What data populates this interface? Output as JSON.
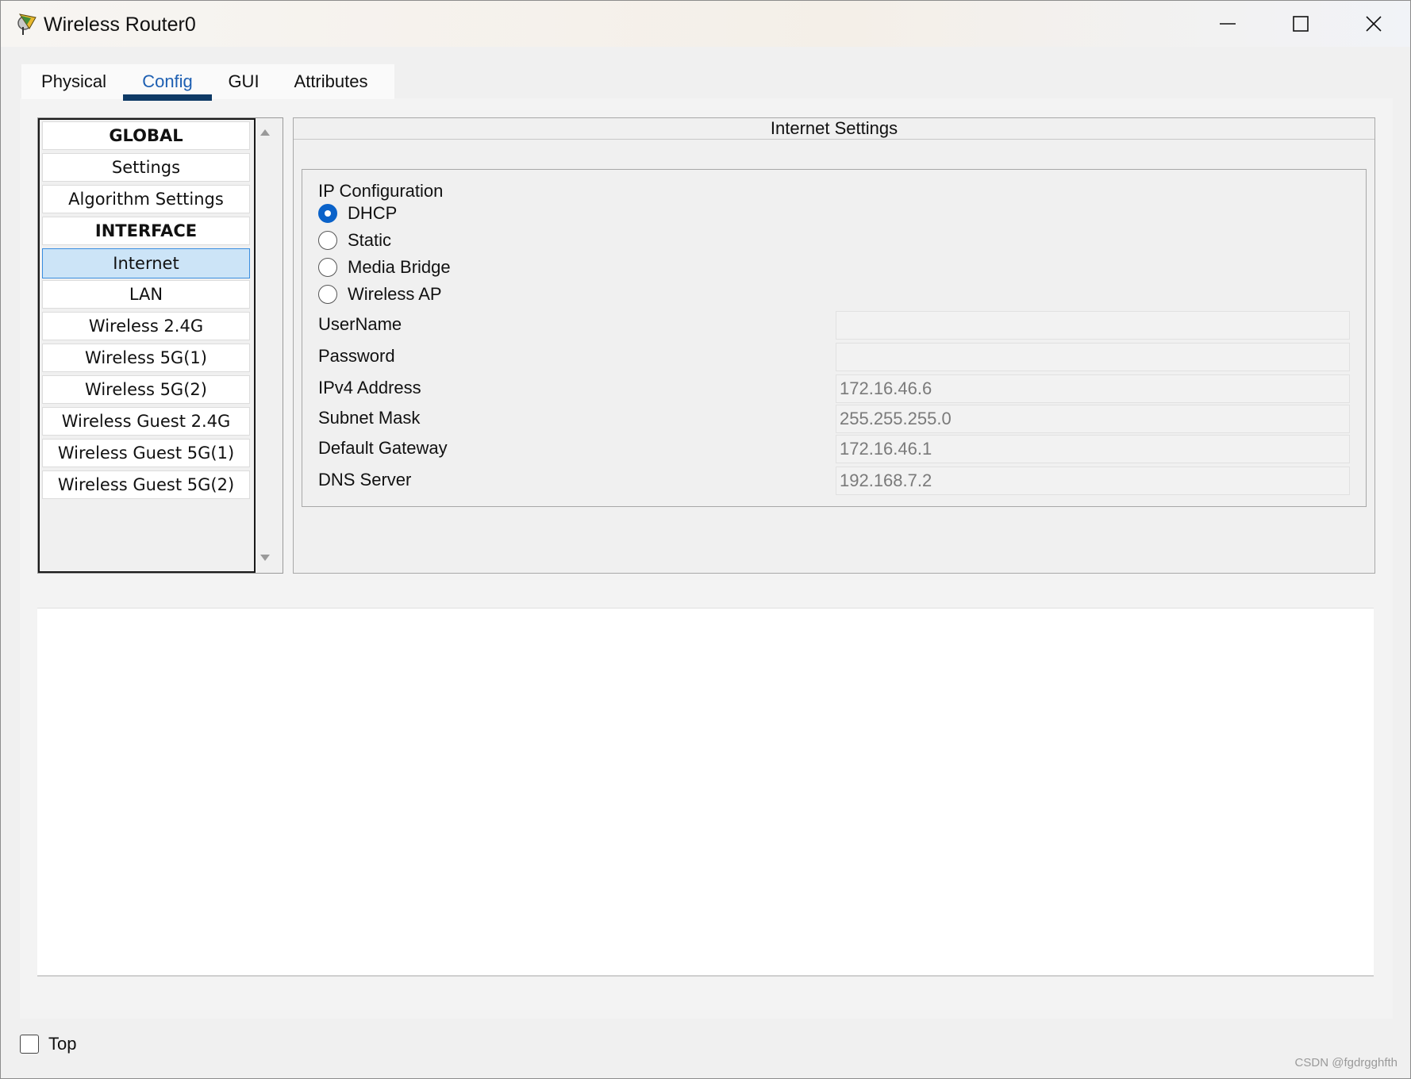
{
  "window": {
    "title": "Wireless Router0"
  },
  "tabs": [
    {
      "label": "Physical"
    },
    {
      "label": "Config"
    },
    {
      "label": "GUI"
    },
    {
      "label": "Attributes"
    }
  ],
  "active_tab": "Config",
  "nav": {
    "items": [
      {
        "label": "GLOBAL",
        "type": "header"
      },
      {
        "label": "Settings",
        "type": "item"
      },
      {
        "label": "Algorithm Settings",
        "type": "item"
      },
      {
        "label": "INTERFACE",
        "type": "header"
      },
      {
        "label": "Internet",
        "type": "item",
        "selected": true
      },
      {
        "label": "LAN",
        "type": "item"
      },
      {
        "label": "Wireless 2.4G",
        "type": "item"
      },
      {
        "label": "Wireless 5G(1)",
        "type": "item"
      },
      {
        "label": "Wireless 5G(2)",
        "type": "item"
      },
      {
        "label": "Wireless Guest 2.4G",
        "type": "item"
      },
      {
        "label": "Wireless Guest 5G(1)",
        "type": "item"
      },
      {
        "label": "Wireless Guest 5G(2)",
        "type": "item"
      }
    ]
  },
  "panel": {
    "title": "Internet Settings",
    "ip_config_label": "IP Configuration",
    "modes": [
      {
        "label": "DHCP",
        "checked": true
      },
      {
        "label": "Static",
        "checked": false
      },
      {
        "label": "Media Bridge",
        "checked": false
      },
      {
        "label": "Wireless AP",
        "checked": false
      }
    ],
    "fields": {
      "username": {
        "label": "UserName",
        "value": ""
      },
      "password": {
        "label": "Password",
        "value": ""
      },
      "ipv4": {
        "label": "IPv4 Address",
        "value": "172.16.46.6"
      },
      "subnet": {
        "label": "Subnet Mask",
        "value": "255.255.255.0"
      },
      "gateway": {
        "label": "Default Gateway",
        "value": "172.16.46.1"
      },
      "dns": {
        "label": "DNS Server",
        "value": "192.168.7.2"
      }
    }
  },
  "footer": {
    "top_label": "Top",
    "watermark": "CSDN @fgdrgghfth"
  },
  "colors": {
    "accent": "#0a62c9",
    "tab_underline": "#0e3a66",
    "selected_bg": "#cce4f7"
  }
}
